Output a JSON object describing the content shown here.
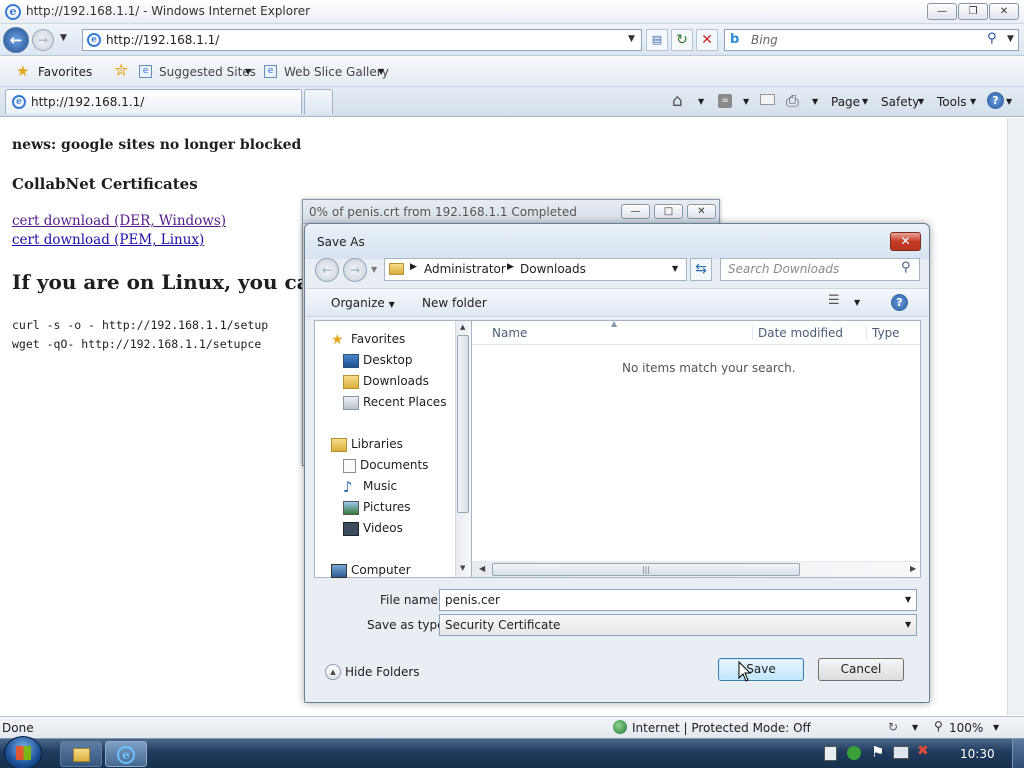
{
  "window": {
    "title": "http://192.168.1.1/ - Windows Internet Explorer"
  },
  "addressbar": {
    "url": "http://192.168.1.1/",
    "search_placeholder": "Bing"
  },
  "favbar": {
    "favorites_label": "Favorites",
    "suggested_sites": "Suggested Sites",
    "web_slice_gallery": "Web Slice Gallery"
  },
  "tab": {
    "label": "http://192.168.1.1/"
  },
  "commandbar": {
    "page": "Page",
    "safety": "Safety",
    "tools": "Tools"
  },
  "content": {
    "news": "news: google sites no longer blocked",
    "heading": "CollabNet Certificates",
    "link1": "cert download (DER, Windows)",
    "link2": "cert download (PEM, Linux)",
    "big_heading": "If you are on Linux, you can",
    "cmd1": "curl -s -o - http://192.168.1.1/setup",
    "cmd2": "wget -qO- http://192.168.1.1/setupce"
  },
  "download_window": {
    "title": "0% of penis.crt from 192.168.1.1 Completed"
  },
  "save_dialog": {
    "title": "Save As",
    "breadcrumb": [
      "Administrator",
      "Downloads"
    ],
    "search_placeholder": "Search Downloads",
    "organize": "Organize",
    "new_folder": "New folder",
    "tree": {
      "favorites": "Favorites",
      "desktop": "Desktop",
      "downloads": "Downloads",
      "recent_places": "Recent Places",
      "libraries": "Libraries",
      "documents": "Documents",
      "music": "Music",
      "pictures": "Pictures",
      "videos": "Videos",
      "computer": "Computer"
    },
    "columns": {
      "name": "Name",
      "date_modified": "Date modified",
      "type": "Type"
    },
    "empty_message": "No items match your search.",
    "file_name_label": "File name:",
    "file_name_value": "penis.cer",
    "save_as_type_label": "Save as type:",
    "save_as_type_value": "Security Certificate",
    "hide_folders": "Hide Folders",
    "save_button": "Save",
    "cancel_button": "Cancel"
  },
  "statusbar": {
    "left": "Done",
    "zone": "Internet | Protected Mode: Off",
    "zoom": "100%"
  },
  "taskbar": {
    "clock": "10:30"
  }
}
